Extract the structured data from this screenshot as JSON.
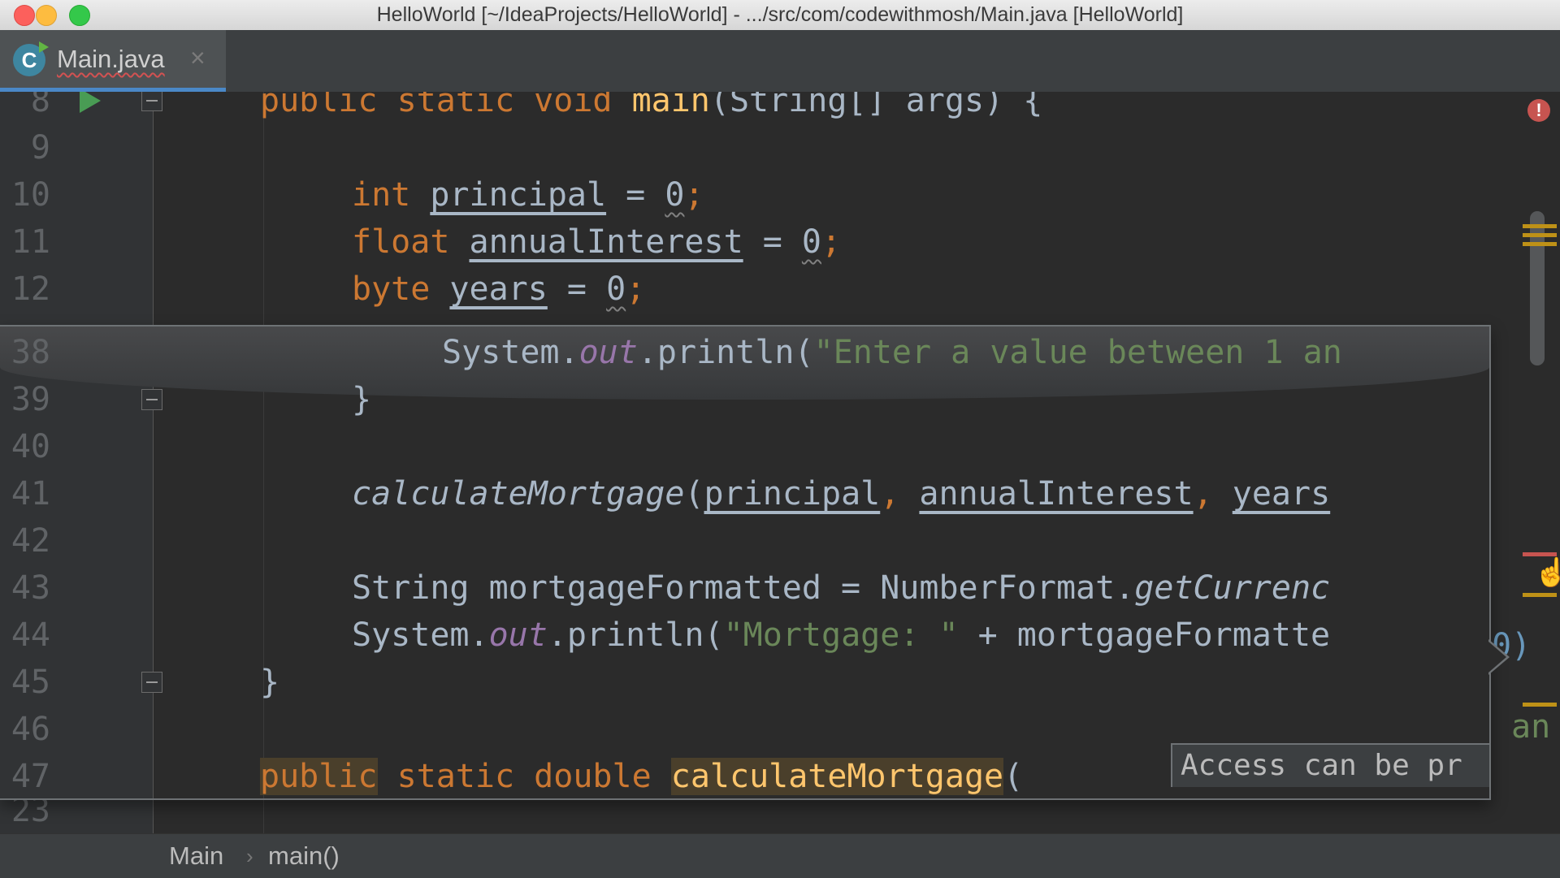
{
  "window": {
    "title": "HelloWorld [~/IdeaProjects/HelloWorld] - .../src/com/codewithmosh/Main.java [HelloWorld]"
  },
  "tab": {
    "label": "Main.java",
    "icon": "java-class-icon",
    "close": "×",
    "class_letter": "C"
  },
  "editor": {
    "line_numbers": [
      "8",
      "9",
      "10",
      "11",
      "12",
      "23"
    ],
    "line8": {
      "t1": "public static void ",
      "t2": "main",
      "t3": "(String[] args) {"
    },
    "line10": {
      "kw": "int ",
      "var": "principal",
      "eq": " = ",
      "zero": "0",
      "semi": ";"
    },
    "line11": {
      "kw": "float ",
      "var": "annualInterest",
      "eq": " = ",
      "zero": "0",
      "semi": ";"
    },
    "line12": {
      "kw": "byte ",
      "var": "years",
      "eq": " = ",
      "zero": "0",
      "semi": ";"
    },
    "error_icon": "!"
  },
  "popup": {
    "line_numbers": [
      "38",
      "39",
      "40",
      "41",
      "42",
      "43",
      "44",
      "45",
      "46",
      "47"
    ],
    "line38": {
      "a": "System.",
      "b": "out",
      "c": ".println(",
      "d": "\"Enter a value between 1 an"
    },
    "line39": "}",
    "line41": {
      "a": "calculateMortgage",
      "b": "(",
      "c": "principal",
      "d": ", ",
      "e": "annualInterest",
      "f": ", ",
      "g": "years"
    },
    "line43": {
      "a": "String mortgageFormatted = NumberFormat.",
      "b": "getCurrenc"
    },
    "line44": {
      "a": "System.",
      "b": "out",
      "c": ".println(",
      "d": "\"Mortgage: \"",
      "e": " + mortgageFormatte"
    },
    "line45": "}",
    "line47": {
      "a": "public",
      "b": " static double ",
      "c": "calculateMortgage",
      "d": "("
    },
    "tooltip": "Access can be pr"
  },
  "right_peek": {
    "line44": "0)",
    "line46": "an"
  },
  "breadcrumb": {
    "items": [
      "Main",
      "main()"
    ],
    "separator": "›"
  }
}
